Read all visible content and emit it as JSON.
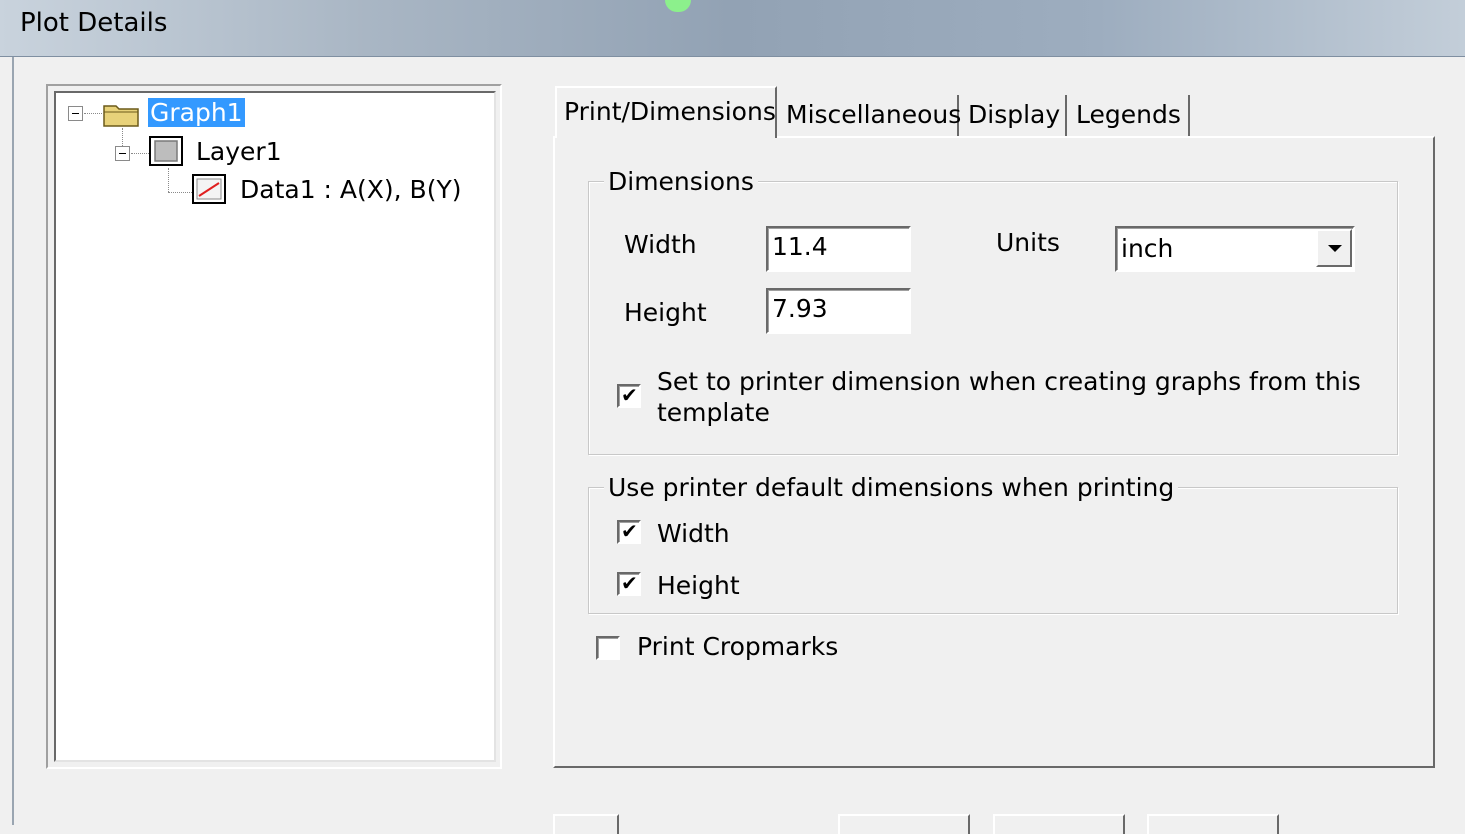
{
  "window": {
    "title": "Plot Details"
  },
  "tree": {
    "graph": "Graph1",
    "layer": "Layer1",
    "data": "Data1 : A(X), B(Y)"
  },
  "tabs": [
    "Print/Dimensions",
    "Miscellaneous",
    "Display",
    "Legends"
  ],
  "dimensions": {
    "group_label": "Dimensions",
    "width_label": "Width",
    "width_value": "11.4",
    "height_label": "Height",
    "height_value": "7.93",
    "units_label": "Units",
    "units_value": "inch",
    "set_printer_label_line1": "Set to printer dimension when creating graphs from this",
    "set_printer_label_line2": "template",
    "set_printer_checked": true
  },
  "printer_defaults": {
    "group_label": "Use printer default dimensions when printing",
    "width_label": "Width",
    "width_checked": true,
    "height_label": "Height",
    "height_checked": true
  },
  "cropmarks": {
    "label": "Print Cropmarks",
    "checked": false
  },
  "colors": {
    "selection": "#3399ff",
    "face": "#f0f0f0"
  }
}
